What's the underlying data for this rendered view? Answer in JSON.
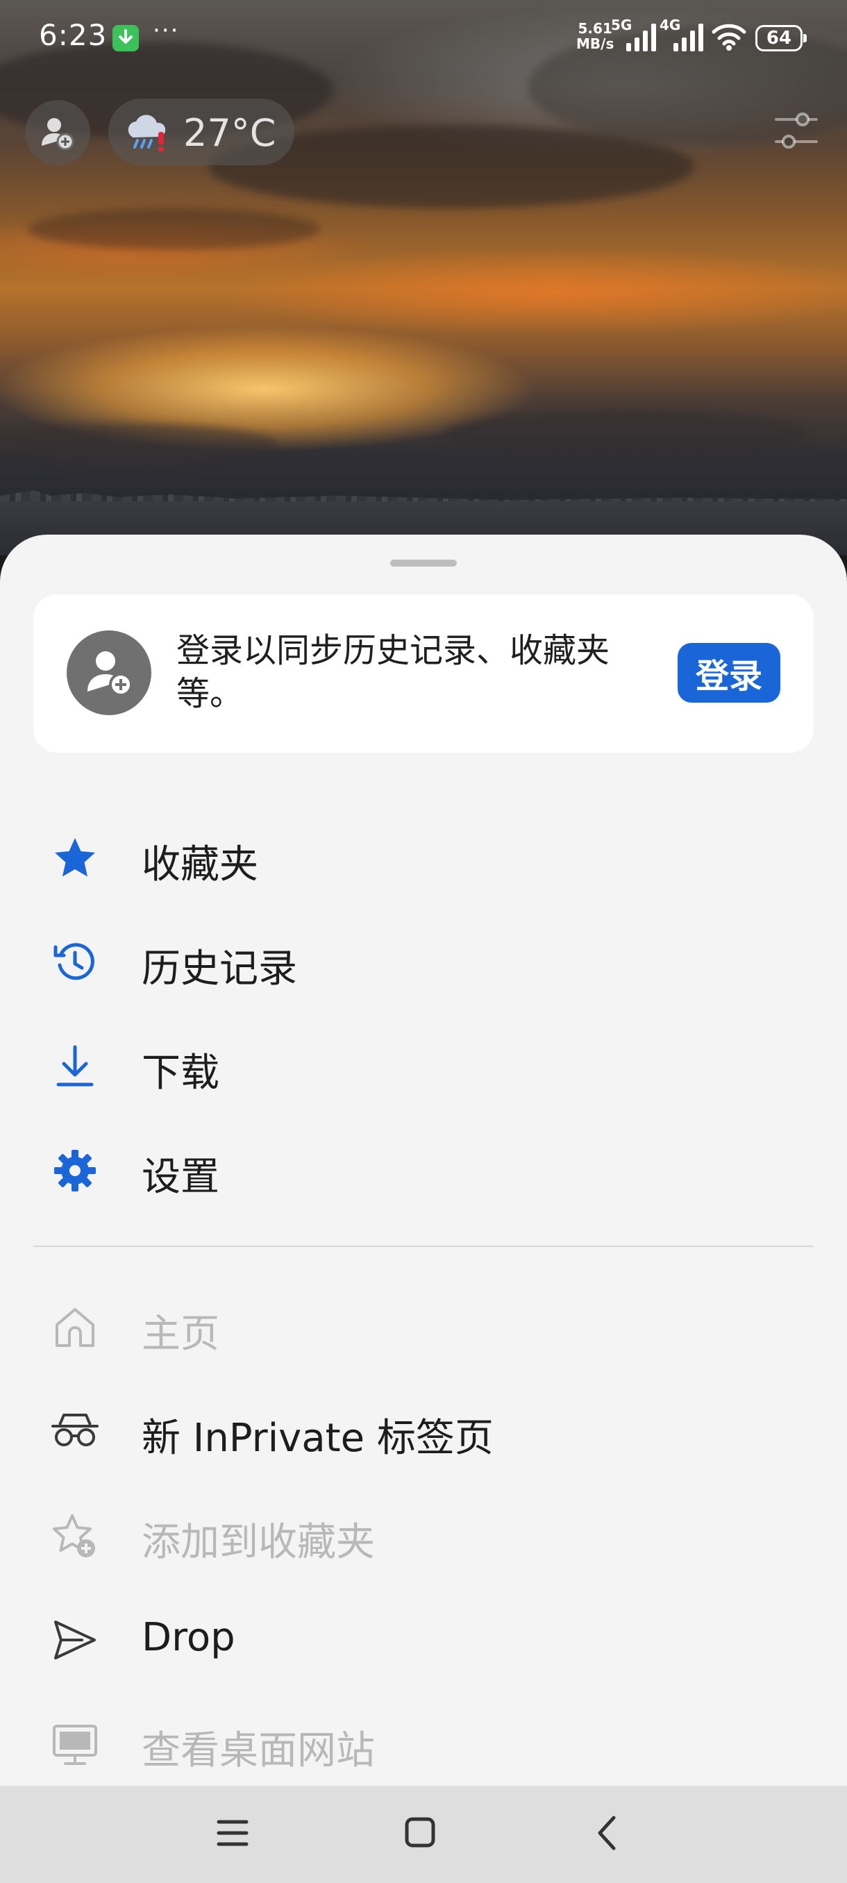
{
  "status_bar": {
    "time": "6:23",
    "more_dots": "···",
    "net_speed_value": "5.61",
    "net_speed_unit": "MB/s",
    "net_5g": "5G",
    "net_4g": "4G",
    "battery": "64"
  },
  "header": {
    "weather_temp": "27°C"
  },
  "sheet": {
    "signin_prompt": "登录以同步历史记录、收藏夹等。",
    "signin_button": "登录",
    "primary_items": [
      {
        "label": "收藏夹",
        "icon": "star-icon",
        "enabled": true
      },
      {
        "label": "历史记录",
        "icon": "history-icon",
        "enabled": true
      },
      {
        "label": "下载",
        "icon": "download-icon",
        "enabled": true
      },
      {
        "label": "设置",
        "icon": "gear-icon",
        "enabled": true
      }
    ],
    "secondary_items": [
      {
        "label": "主页",
        "icon": "home-icon",
        "enabled": false
      },
      {
        "label": "新 InPrivate 标签页",
        "icon": "inprivate-icon",
        "enabled": true
      },
      {
        "label": "添加到收藏夹",
        "icon": "add-favorite-icon",
        "enabled": false
      },
      {
        "label": "Drop",
        "icon": "send-icon",
        "enabled": true
      },
      {
        "label": "查看桌面网站",
        "icon": "desktop-icon",
        "enabled": false
      }
    ]
  },
  "colors": {
    "accent": "#1a66d9",
    "disabled": "#b8b8b8",
    "sheet_bg": "#f4f4f4"
  }
}
